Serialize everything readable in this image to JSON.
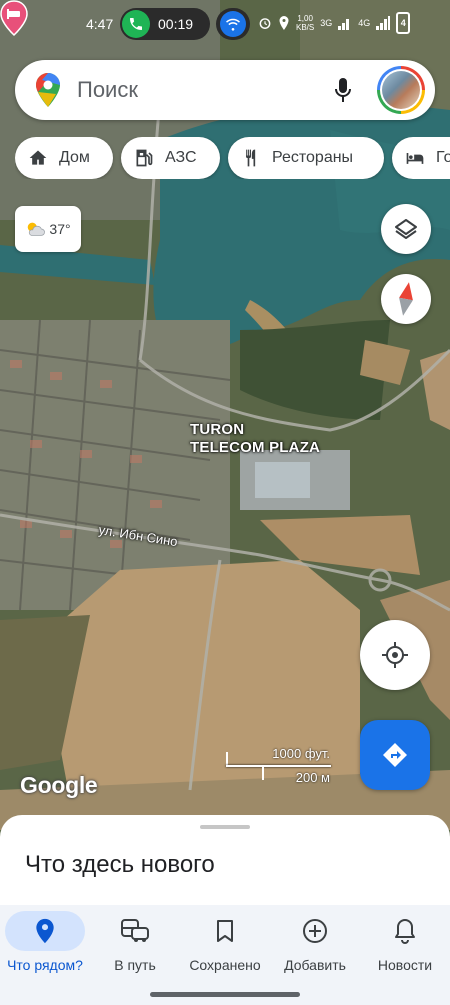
{
  "status_bar": {
    "time": "4:47",
    "call_timer": "00:19",
    "net_speed": "1,00",
    "net_unit": "KB/S",
    "signal1": "3G",
    "signal2": "4G",
    "battery": "4"
  },
  "search": {
    "placeholder": "Поиск"
  },
  "chips": [
    {
      "label": "Дом",
      "icon": "home-icon"
    },
    {
      "label": "АЗС",
      "icon": "gas-station-icon"
    },
    {
      "label": "Рестораны",
      "icon": "restaurant-icon"
    },
    {
      "label": "Го",
      "icon": "hotel-icon"
    }
  ],
  "weather": {
    "temperature": "37°",
    "icon": "partly-cloudy-icon"
  },
  "map": {
    "poi_name_line1": "TURON",
    "poi_name_line2": "TELECOM PLAZA",
    "street": "ул. Ибн Сино",
    "attribution": "Google",
    "scale_imperial": "1000 фут.",
    "scale_metric": "200 м"
  },
  "sheet": {
    "title": "Что здесь нового"
  },
  "nav": [
    {
      "label": "Что рядом?",
      "icon": "location-pin-icon",
      "active": true
    },
    {
      "label": "В путь",
      "icon": "commute-icon",
      "active": false
    },
    {
      "label": "Сохранено",
      "icon": "bookmark-icon",
      "active": false
    },
    {
      "label": "Добавить",
      "icon": "add-circle-icon",
      "active": false
    },
    {
      "label": "Новости",
      "icon": "bell-icon",
      "active": false
    }
  ],
  "colors": {
    "accent": "#1a73e8",
    "active_nav_bg": "#d3e3fd",
    "poi_pin": "#e8507a",
    "call_green": "#1fb455",
    "water": "#2f6f72"
  }
}
